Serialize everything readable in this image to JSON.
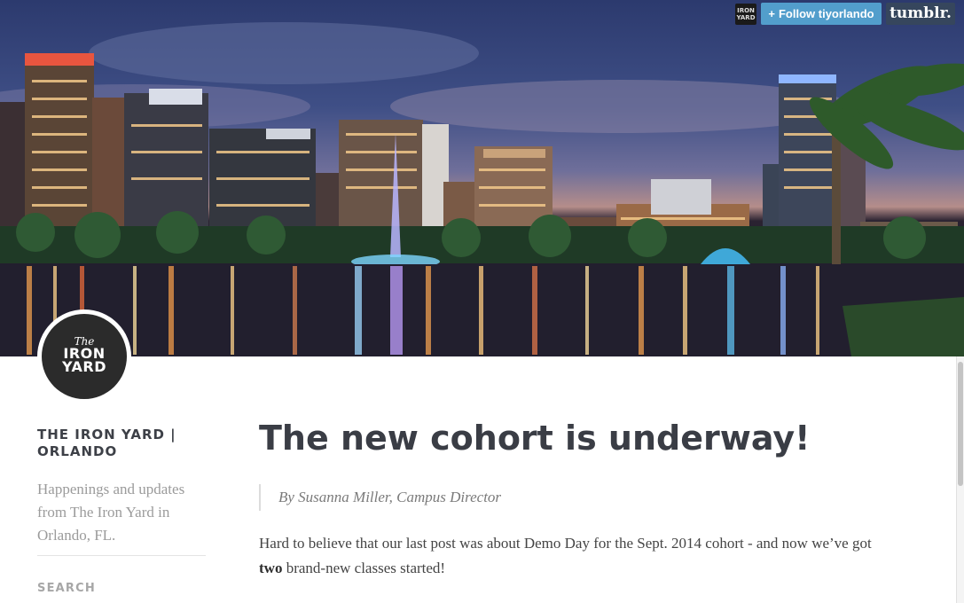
{
  "tumblr_bar": {
    "avatar_text": "IRON\nYARD",
    "follow_plus": "+",
    "follow_label": "Follow tiyorlando",
    "logo": "tumblr."
  },
  "avatar": {
    "line1": "The",
    "line2": "IRON",
    "line3": "YARD"
  },
  "sidebar": {
    "blog_title": "THE IRON YARD | ORLANDO",
    "description": "Happenings and updates from The Iron Yard in Orlando, FL.",
    "search_label": "SEARCH"
  },
  "post": {
    "title": "The new cohort is underway!",
    "byline": "By Susanna Miller, Campus Director",
    "body_part1": "Hard to believe that our last post was about Demo Day for the Sept. 2014 cohort - and now we’ve got ",
    "body_bold": "two",
    "body_part2": " brand-new classes started!"
  },
  "colors": {
    "follow_button": "#529ecc",
    "tumblr_logo_bg": "#36465d",
    "title_text": "#3a3d45"
  }
}
